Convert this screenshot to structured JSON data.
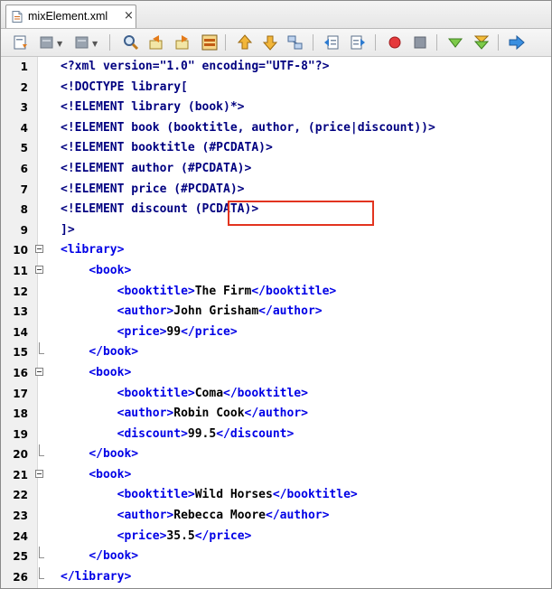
{
  "tab": {
    "label": "mixElement.xml",
    "close": "×"
  },
  "toolbar": {
    "icons": [
      "last-edit-icon",
      "back-dropdown-icon",
      "forward-dropdown-icon",
      "find-icon",
      "find-previous-icon",
      "find-next-icon",
      "toggle-highlight-icon",
      "previous-bookmark-icon",
      "next-bookmark-icon",
      "toggle-bookmark-icon",
      "shift-left-icon",
      "shift-right-icon",
      "start-macro-icon",
      "stop-macro-icon",
      "check-xml-icon",
      "validate-xml-icon",
      "xsl-transform-icon"
    ]
  },
  "colors": {
    "tag": "#0000e6",
    "text": "#000000",
    "doctype": "#000080",
    "highlight_box": "#e2341f"
  },
  "lines": [
    {
      "n": "1",
      "fold": "",
      "segs": [
        {
          "k": "dt",
          "t": "<?xml version=\"1.0\" encoding=\"UTF-8\"?>"
        }
      ]
    },
    {
      "n": "2",
      "fold": "",
      "segs": [
        {
          "k": "dt",
          "t": "<!DOCTYPE library["
        }
      ]
    },
    {
      "n": "3",
      "fold": "",
      "segs": [
        {
          "k": "dt",
          "t": "<!ELEMENT library (book)*>"
        }
      ]
    },
    {
      "n": "4",
      "fold": "",
      "segs": [
        {
          "k": "dt",
          "t": "<!ELEMENT book (booktitle, author, (price|discount))>"
        }
      ]
    },
    {
      "n": "5",
      "fold": "",
      "segs": [
        {
          "k": "dt",
          "t": "<!ELEMENT booktitle (#PCDATA)>"
        }
      ]
    },
    {
      "n": "6",
      "fold": "",
      "segs": [
        {
          "k": "dt",
          "t": "<!ELEMENT author (#PCDATA)>"
        }
      ]
    },
    {
      "n": "7",
      "fold": "",
      "segs": [
        {
          "k": "dt",
          "t": "<!ELEMENT price (#PCDATA)>"
        }
      ]
    },
    {
      "n": "8",
      "fold": "",
      "segs": [
        {
          "k": "dt",
          "t": "<!ELEMENT discount (PCDATA)>"
        }
      ]
    },
    {
      "n": "9",
      "fold": "",
      "segs": [
        {
          "k": "dt",
          "t": "]>"
        }
      ]
    },
    {
      "n": "10",
      "fold": "open",
      "segs": [
        {
          "k": "tag",
          "t": "<library>"
        }
      ]
    },
    {
      "n": "11",
      "fold": "open",
      "segs": [
        {
          "k": "sp",
          "t": "    "
        },
        {
          "k": "tag",
          "t": "<book>"
        }
      ]
    },
    {
      "n": "12",
      "fold": "",
      "segs": [
        {
          "k": "sp",
          "t": "        "
        },
        {
          "k": "tag",
          "t": "<booktitle>"
        },
        {
          "k": "txt",
          "t": "The Firm"
        },
        {
          "k": "tag",
          "t": "</booktitle>"
        }
      ]
    },
    {
      "n": "13",
      "fold": "",
      "segs": [
        {
          "k": "sp",
          "t": "        "
        },
        {
          "k": "tag",
          "t": "<author>"
        },
        {
          "k": "txt",
          "t": "John Grisham"
        },
        {
          "k": "tag",
          "t": "</author>"
        }
      ]
    },
    {
      "n": "14",
      "fold": "",
      "segs": [
        {
          "k": "sp",
          "t": "        "
        },
        {
          "k": "tag",
          "t": "<price>"
        },
        {
          "k": "txt",
          "t": "99"
        },
        {
          "k": "tag",
          "t": "</price>"
        }
      ]
    },
    {
      "n": "15",
      "fold": "end",
      "segs": [
        {
          "k": "sp",
          "t": "    "
        },
        {
          "k": "tag",
          "t": "</book>"
        }
      ]
    },
    {
      "n": "16",
      "fold": "open",
      "segs": [
        {
          "k": "sp",
          "t": "    "
        },
        {
          "k": "tag",
          "t": "<book>"
        }
      ]
    },
    {
      "n": "17",
      "fold": "",
      "segs": [
        {
          "k": "sp",
          "t": "        "
        },
        {
          "k": "tag",
          "t": "<booktitle>"
        },
        {
          "k": "txt",
          "t": "Coma"
        },
        {
          "k": "tag",
          "t": "</booktitle>"
        }
      ]
    },
    {
      "n": "18",
      "fold": "",
      "segs": [
        {
          "k": "sp",
          "t": "        "
        },
        {
          "k": "tag",
          "t": "<author>"
        },
        {
          "k": "txt",
          "t": "Robin Cook"
        },
        {
          "k": "tag",
          "t": "</author>"
        }
      ]
    },
    {
      "n": "19",
      "fold": "",
      "segs": [
        {
          "k": "sp",
          "t": "        "
        },
        {
          "k": "tag",
          "t": "<discount>"
        },
        {
          "k": "txt",
          "t": "99.5"
        },
        {
          "k": "tag",
          "t": "</discount>"
        }
      ]
    },
    {
      "n": "20",
      "fold": "end",
      "segs": [
        {
          "k": "sp",
          "t": "    "
        },
        {
          "k": "tag",
          "t": "</book>"
        }
      ]
    },
    {
      "n": "21",
      "fold": "open",
      "segs": [
        {
          "k": "sp",
          "t": "    "
        },
        {
          "k": "tag",
          "t": "<book>"
        }
      ]
    },
    {
      "n": "22",
      "fold": "",
      "segs": [
        {
          "k": "sp",
          "t": "        "
        },
        {
          "k": "tag",
          "t": "<booktitle>"
        },
        {
          "k": "txt",
          "t": "Wild Horses"
        },
        {
          "k": "tag",
          "t": "</booktitle>"
        }
      ]
    },
    {
      "n": "23",
      "fold": "",
      "segs": [
        {
          "k": "sp",
          "t": "        "
        },
        {
          "k": "tag",
          "t": "<author>"
        },
        {
          "k": "txt",
          "t": "Rebecca Moore"
        },
        {
          "k": "tag",
          "t": "</author>"
        }
      ]
    },
    {
      "n": "24",
      "fold": "",
      "segs": [
        {
          "k": "sp",
          "t": "        "
        },
        {
          "k": "tag",
          "t": "<price>"
        },
        {
          "k": "txt",
          "t": "35.5"
        },
        {
          "k": "tag",
          "t": "</price>"
        }
      ]
    },
    {
      "n": "25",
      "fold": "end",
      "segs": [
        {
          "k": "sp",
          "t": "    "
        },
        {
          "k": "tag",
          "t": "</book>"
        }
      ]
    },
    {
      "n": "26",
      "fold": "end",
      "segs": [
        {
          "k": "tag",
          "t": "</library>"
        }
      ]
    }
  ]
}
